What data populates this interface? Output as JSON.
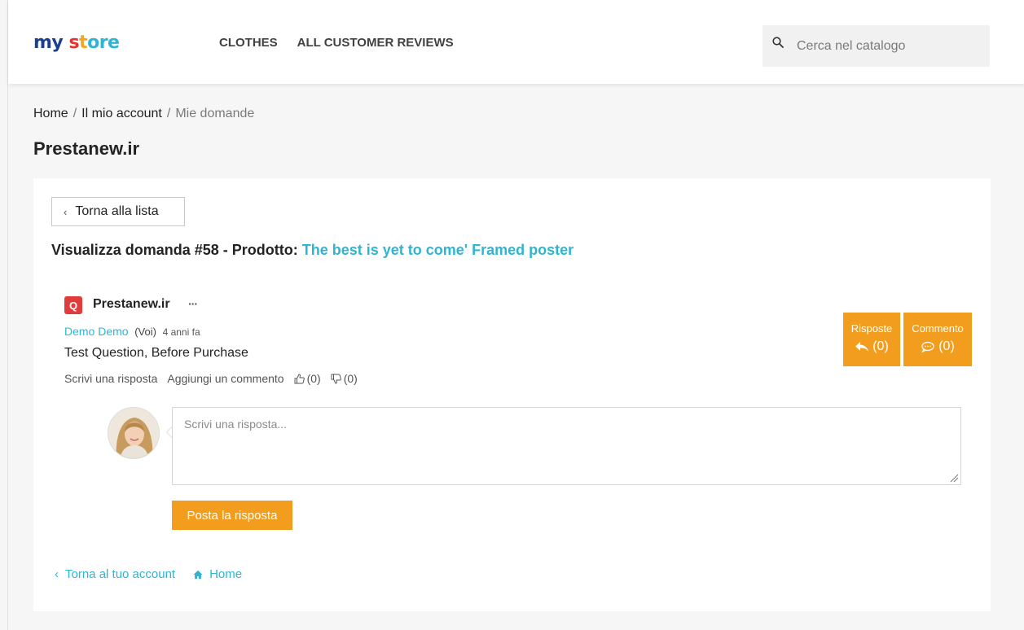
{
  "header": {
    "logo": {
      "part1": "my",
      "part2a": "s",
      "part2b": "t",
      "part2c": "ore"
    },
    "nav": [
      "CLOTHES",
      "ALL CUSTOMER REVIEWS"
    ],
    "search_placeholder": "Cerca nel catalogo"
  },
  "breadcrumb": {
    "items": [
      "Home",
      "Il mio account",
      "Mie domande"
    ],
    "separator": "/"
  },
  "page_title": "Prestanew.ir",
  "card": {
    "back_label": "Torna alla lista",
    "heading_prefix": "Visualizza domanda #58 - Prodotto: ",
    "product_name": "The best is yet to come' Framed poster",
    "question": {
      "badge": "Q",
      "author": "Prestanew.ir",
      "menu_dots": "···",
      "customer_name": "Demo Demo",
      "you_label": "(Voi)",
      "time_ago": "4 anni fa",
      "text": "Test Question, Before Purchase",
      "write_answer": "Scrivi una risposta",
      "add_comment": "Aggiungi un commento",
      "likes": "(0)",
      "dislikes": "(0)"
    },
    "stats": {
      "answers_label": "Risposte",
      "answers_count": "(0)",
      "comments_label": "Commento",
      "comments_count": "(0)"
    },
    "reply_placeholder": "Scrivi una risposta...",
    "post_button": "Posta la risposta"
  },
  "footer_links": {
    "back_account": "Torna al tuo account",
    "home": "Home"
  },
  "colors": {
    "accent": "#2fb5d2",
    "orange": "#f39d1f",
    "badge_red": "#e03c3c"
  }
}
